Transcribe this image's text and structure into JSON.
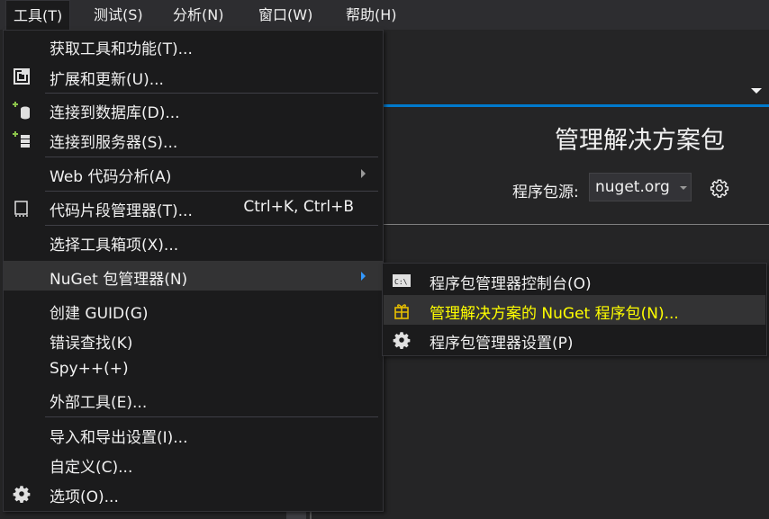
{
  "menubar": {
    "items": [
      "工具(T)",
      "测试(S)",
      "分析(N)",
      "窗口(W)",
      "帮助(H)"
    ]
  },
  "background": {
    "page_title": "管理解决方案包",
    "package_source_label": "程序包源:",
    "package_source_value": "nuget.org"
  },
  "tools_menu": {
    "items": [
      {
        "label": "获取工具和功能(T)...",
        "icon": "none"
      },
      {
        "label": "扩展和更新(U)...",
        "icon": "extensions-icon"
      },
      {
        "label": "连接到数据库(D)...",
        "icon": "database-connect-icon"
      },
      {
        "label": "连接到服务器(S)...",
        "icon": "server-connect-icon"
      },
      {
        "label": "Web 代码分析(A)",
        "icon": "none",
        "submenu": true
      },
      {
        "label": "代码片段管理器(T)...",
        "shortcut": "Ctrl+K, Ctrl+B",
        "icon": "snippet-icon"
      },
      {
        "label": "选择工具箱项(X)...",
        "icon": "none"
      },
      {
        "label": "NuGet 包管理器(N)",
        "icon": "none",
        "submenu": true,
        "highlighted": true
      },
      {
        "label": "创建 GUID(G)",
        "icon": "none"
      },
      {
        "label": "错误查找(K)",
        "icon": "none"
      },
      {
        "label": "Spy++(+)",
        "icon": "none"
      },
      {
        "label": "外部工具(E)...",
        "icon": "none"
      },
      {
        "label": "导入和导出设置(I)...",
        "icon": "none"
      },
      {
        "label": "自定义(C)...",
        "icon": "none"
      },
      {
        "label": "选项(O)...",
        "icon": "gear-icon"
      }
    ]
  },
  "nuget_submenu": {
    "items": [
      {
        "label": "程序包管理器控制台(O)",
        "icon": "console-icon"
      },
      {
        "label": "管理解决方案的 NuGet 程序包(N)...",
        "icon": "package-icon",
        "highlighted": true
      },
      {
        "label": "程序包管理器设置(P)",
        "icon": "gear-icon"
      }
    ]
  },
  "colors": {
    "accent": "#007acc",
    "highlight_text": "#ffff00",
    "menu_bg": "#1b1b1c"
  }
}
